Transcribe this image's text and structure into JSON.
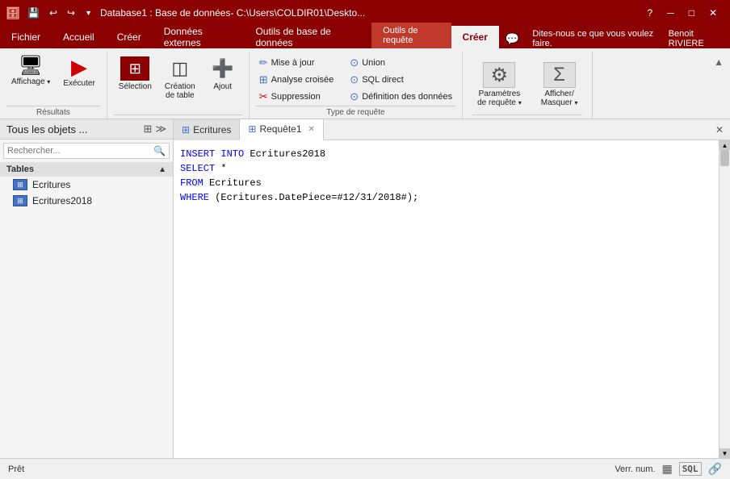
{
  "titlebar": {
    "title": "Database1 : Base de données- C:\\Users\\COLDIR01\\Deskto...",
    "qat_buttons": [
      "save",
      "undo",
      "redo",
      "customize"
    ],
    "win_buttons": [
      "minimize",
      "maximize",
      "close"
    ],
    "help_char": "?"
  },
  "ribbon_tabs": {
    "left_tabs": [
      {
        "label": "Fichier",
        "active": false
      },
      {
        "label": "Accueil",
        "active": false
      },
      {
        "label": "Créer",
        "active": false
      },
      {
        "label": "Données externes",
        "active": false
      },
      {
        "label": "Outils de base de données",
        "active": false
      },
      {
        "label": "Créer",
        "active": true
      }
    ],
    "context_tab": "Outils de requête",
    "help_label": "?",
    "user_label": "Benoit RIVIERE"
  },
  "ribbon": {
    "groups": [
      {
        "name": "Résultats",
        "buttons": [
          {
            "label": "Affichage",
            "type": "large",
            "icon": "🖥"
          },
          {
            "label": "Exécuter",
            "type": "large",
            "icon": "▶"
          }
        ]
      },
      {
        "name": "",
        "buttons_large": [
          {
            "label": "Sélection",
            "type": "large",
            "icon": "▦"
          },
          {
            "label": "Création\nde table",
            "type": "large",
            "icon": "◫"
          },
          {
            "label": "Ajout",
            "type": "large",
            "icon": "➕"
          }
        ]
      },
      {
        "name": "Type de requête",
        "small_buttons": [
          {
            "label": "Mise à jour",
            "icon": "✏"
          },
          {
            "label": "Analyse croisée",
            "icon": "⊞"
          },
          {
            "label": "Suppression",
            "icon": "✂"
          },
          {
            "label": "Union",
            "icon": "⊙"
          },
          {
            "label": "SQL direct",
            "icon": "⊙"
          },
          {
            "label": "Définition des données",
            "icon": "⊙"
          }
        ]
      },
      {
        "name": "",
        "special_buttons": [
          {
            "label": "Paramètres\nde requête",
            "icon": "⚙"
          },
          {
            "label": "Afficher/\nMasquer",
            "icon": "Σ"
          }
        ]
      }
    ]
  },
  "left_panel": {
    "title": "Tous les objets ...",
    "search_placeholder": "Rechercher...",
    "sections": [
      {
        "name": "Tables",
        "items": [
          "Ecritures",
          "Ecritures2018"
        ]
      }
    ]
  },
  "query_tabs": {
    "tabs": [
      {
        "label": "Ecritures",
        "active": false,
        "closable": false
      },
      {
        "label": "Requête1",
        "active": true,
        "closable": true
      }
    ],
    "close_all": "✕"
  },
  "query_editor": {
    "lines": [
      "INSERT INTO Ecritures2018",
      "SELECT *",
      "FROM Ecritures",
      "WHERE (Ecritures.DatePiece=#12/31/2018#);"
    ]
  },
  "status_bar": {
    "status": "Prêt",
    "verr_num": "Verr. num.",
    "icons": [
      "table-view",
      "sql-view",
      "shortcut"
    ]
  }
}
